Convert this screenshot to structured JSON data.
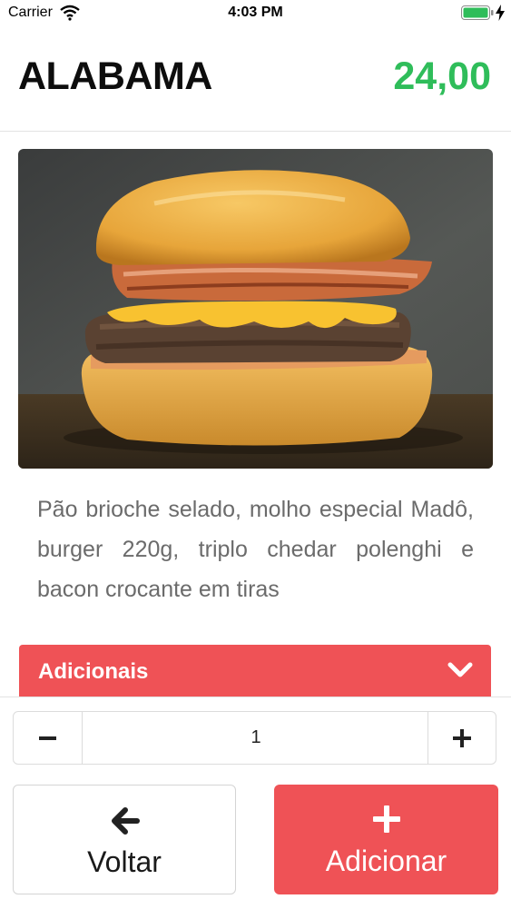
{
  "status_bar": {
    "carrier": "Carrier",
    "time": "4:03 PM",
    "icons": [
      "wifi-icon",
      "battery-icon",
      "charging-bolt-icon"
    ],
    "battery_color": "#2fbd5a"
  },
  "product": {
    "name": "ALABAMA",
    "price": "24,00",
    "price_color": "#2fbd5a",
    "image": "burger-photo",
    "description": "Pão brioche selado, molho especial Madô, burger 220g, triplo chedar polenghi e bacon crocante em tiras"
  },
  "extras": {
    "label": "Adicionais",
    "icon": "chevron-down-icon",
    "color": "#ef5256"
  },
  "quantity": {
    "value": "1",
    "decrement_icon": "minus-icon",
    "increment_icon": "plus-icon"
  },
  "actions": {
    "back_label": "Voltar",
    "back_icon": "arrow-left-icon",
    "add_label": "Adicionar",
    "add_icon": "plus-icon",
    "add_color": "#ef5256"
  }
}
